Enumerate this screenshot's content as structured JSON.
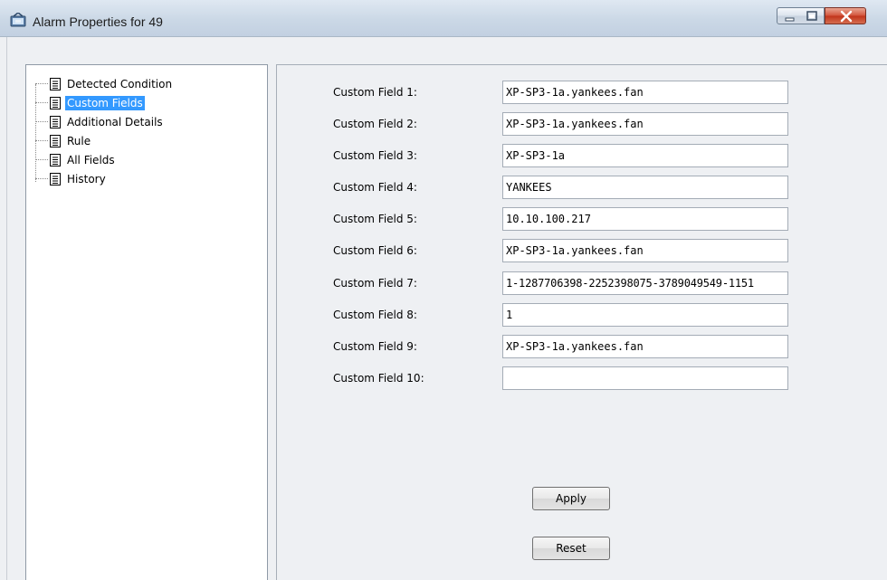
{
  "window": {
    "title": "Alarm Properties for 49",
    "controls": {
      "minimize": "minimize-icon",
      "maximize": "maximize-icon",
      "close": "close-icon"
    }
  },
  "tree": {
    "items": [
      {
        "label": "Detected Condition",
        "icon": "document-icon",
        "selected": false
      },
      {
        "label": "Custom Fields",
        "icon": "document-icon",
        "selected": true
      },
      {
        "label": "Additional Details",
        "icon": "document-icon",
        "selected": false
      },
      {
        "label": "Rule",
        "icon": "document-icon",
        "selected": false
      },
      {
        "label": "All Fields",
        "icon": "document-icon",
        "selected": false
      },
      {
        "label": "History",
        "icon": "document-icon",
        "selected": false
      }
    ]
  },
  "fields": [
    {
      "label": "Custom Field 1:",
      "value": "XP-SP3-1a.yankees.fan"
    },
    {
      "label": "Custom Field 2:",
      "value": "XP-SP3-1a.yankees.fan"
    },
    {
      "label": "Custom Field 3:",
      "value": "XP-SP3-1a"
    },
    {
      "label": "Custom Field 4:",
      "value": "YANKEES"
    },
    {
      "label": "Custom Field 5:",
      "value": "10.10.100.217"
    },
    {
      "label": "Custom Field 6:",
      "value": "XP-SP3-1a.yankees.fan"
    },
    {
      "label": "Custom Field 7:",
      "value": "1-1287706398-2252398075-3789049549-1151"
    },
    {
      "label": "Custom Field 8:",
      "value": "1"
    },
    {
      "label": "Custom Field 9:",
      "value": "XP-SP3-1a.yankees.fan"
    },
    {
      "label": "Custom Field 10:",
      "value": ""
    }
  ],
  "buttons": {
    "apply": "Apply",
    "reset": "Reset"
  },
  "colors": {
    "selection": "#3399ff",
    "titlebar": "#cbd8e6",
    "close": "#c1331a"
  }
}
